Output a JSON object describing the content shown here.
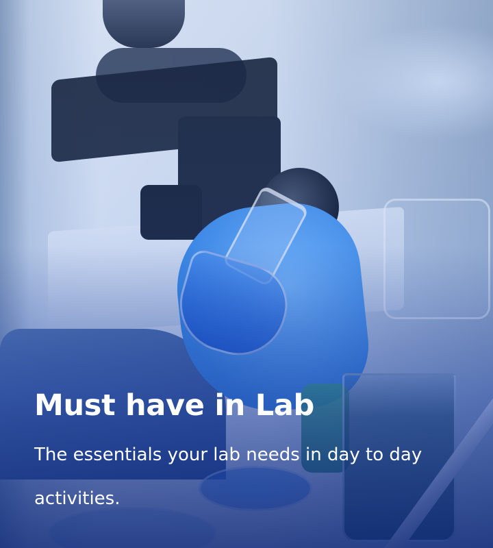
{
  "banner": {
    "title": "Must have in Lab",
    "subtitle": "The essentials your lab needs in day to day activities."
  },
  "theme": {
    "overlay_color": "#1e50c8",
    "text_color": "#ffffff"
  }
}
